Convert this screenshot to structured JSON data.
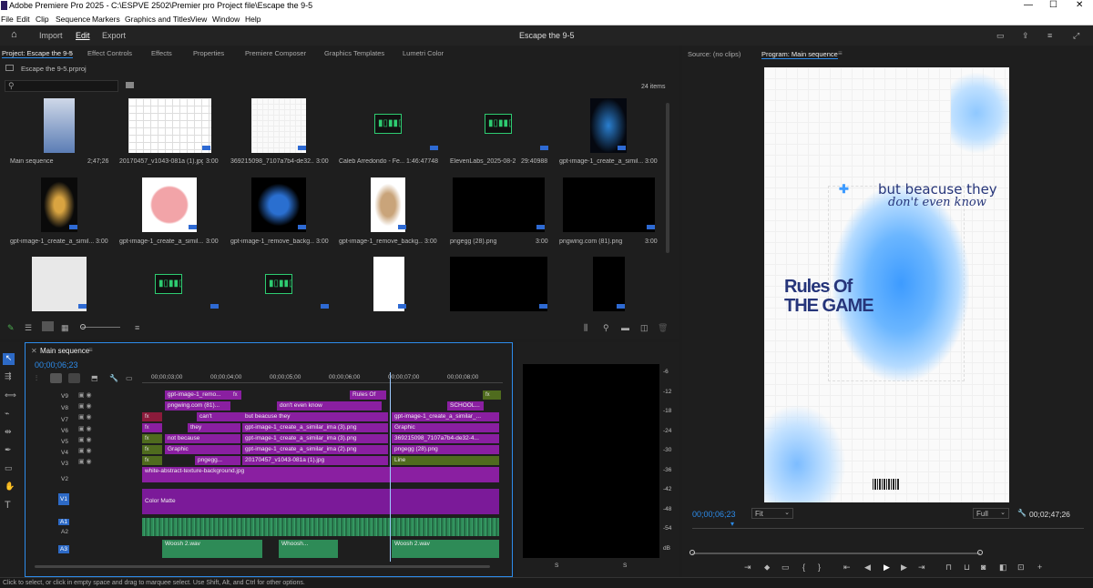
{
  "window": {
    "title": "Adobe Premiere Pro 2025 - C:\\ESPVE 2502\\Premier pro Project file\\Escape the 9-5",
    "min": "—",
    "max": "☐",
    "close": "✕"
  },
  "menu": [
    "File",
    "Edit",
    "Clip",
    "Sequence",
    "Markers",
    "Graphics and Titles",
    "View",
    "Window",
    "Help"
  ],
  "appbar": {
    "import": "Import",
    "edit": "Edit",
    "export": "Export",
    "project_title": "Escape the 9-5"
  },
  "left_tabs": [
    "Project: Escape the 9-5",
    "Effect Controls",
    "Effects",
    "Properties",
    "Premiere Composer",
    "Graphics Templates",
    "Lumetri Color"
  ],
  "project": {
    "file": "Escape the 9-5.prproj",
    "search_placeholder": "",
    "count": "24 items",
    "items": [
      {
        "name": "Main sequence",
        "dur": "2;47;26"
      },
      {
        "name": "20170457_v1043-081a (1).jpg",
        "dur": "3:00"
      },
      {
        "name": "369215098_7107a7b4-de32...",
        "dur": "3:00"
      },
      {
        "name": "Caleb Arredondo - Fe...",
        "dur": "1:46:47748"
      },
      {
        "name": "ElevenLabs_2025-08-2...",
        "dur": "29:40988"
      },
      {
        "name": "gpt-image-1_create_a_simil...",
        "dur": "3:00"
      },
      {
        "name": "gpt-image-1_create_a_simil...",
        "dur": "3:00"
      },
      {
        "name": "gpt-image-1_create_a_simil...",
        "dur": "3:00"
      },
      {
        "name": "gpt-image-1_remove_backg...",
        "dur": "3:00"
      },
      {
        "name": "gpt-image-1_remove_backg...",
        "dur": "3:00"
      },
      {
        "name": "pngegg (28).png",
        "dur": "3:00"
      },
      {
        "name": "pngwing.com (81).png",
        "dur": "3:00"
      }
    ]
  },
  "timeline": {
    "tab": "Main sequence",
    "timecode": "00;00;06;23",
    "ruler": [
      "00;00;03;00",
      "00;00;04;00",
      "00;00;05;00",
      "00;00;06;00",
      "00;00;07;00",
      "00;00;08;00"
    ],
    "tracks": [
      "V9",
      "V8",
      "V7",
      "V6",
      "V5",
      "V4",
      "V3",
      "V2",
      "V1",
      "A1",
      "A2",
      "A3"
    ],
    "clips": {
      "v9a": "gpt-image-1_remo...",
      "v9b": "Rules Of",
      "v8a": "pngwing.com (81)...",
      "v8b": "don't even know",
      "v8c": "SCHOOL...",
      "v7a": "can't",
      "v7b": "but beacuse they",
      "v7c": "gpt-image-1_create_a_similar_...",
      "v6a": "they",
      "v6b": "gpt-image-1_create_a_similar_ima (3).png",
      "v6c": "Graphic",
      "v5a": "not because",
      "v5b": "gpt-image-1_create_a_similar_ima (3).png",
      "v5c": "369215098_7107a7b4-de32-4...",
      "v4a": "Graphic",
      "v4b": "gpt-image-1_create_a_similar_ima (2).png",
      "v4c": "pngegg (28).png",
      "v3a": "pngegg...",
      "v3b": "20170457_v1043-081a (1).jpg",
      "v3c": "Line",
      "v2": "white-abstract-texture-background.jpg",
      "v1": "Color Matte",
      "a3a": "Woosh 2.wav",
      "a3b": "Whoosh...",
      "a3c": "Woosh 2.wav"
    }
  },
  "meter": {
    "ticks": [
      "-6",
      "-12",
      "-18",
      "-24",
      "-30",
      "-36",
      "-42",
      "-48",
      "-54",
      "dB"
    ],
    "s1": "S",
    "s2": "S"
  },
  "monitor": {
    "source_tab": "Source: (no clips)",
    "program_tab": "Program: Main sequence",
    "timecode": "00;00;06;23",
    "fit": "Fit",
    "quality": "Full",
    "duration": "00;02;47;26",
    "overlay_line1": "but beacuse they",
    "overlay_line2": "don't even know",
    "title_line1": "Rules Of",
    "title_line2": "THE GAME"
  },
  "status": "Click to select, or click in empty space and drag to marquee select. Use Shift, Alt, and Ctrl for other options.",
  "colors": {
    "accent": "#2d8ceb",
    "clip_purple": "#8a1fa1",
    "clip_green": "#4f6b1e",
    "audio_green": "#2e8b57",
    "v1_purple": "#7b1a99"
  }
}
